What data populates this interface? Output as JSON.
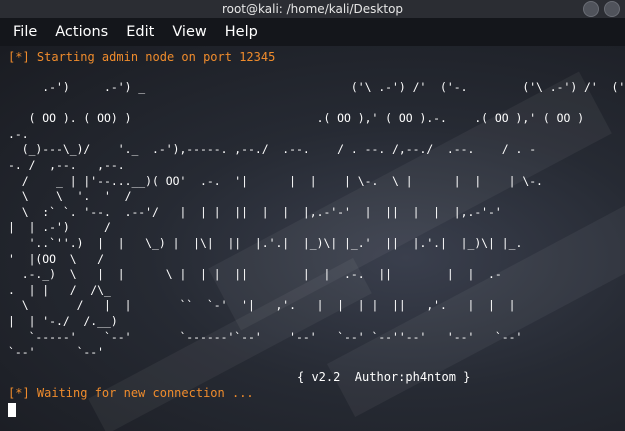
{
  "window": {
    "title": "root@kali: /home/kali/Desktop"
  },
  "menu": {
    "items": [
      "File",
      "Actions",
      "Edit",
      "View",
      "Help"
    ]
  },
  "terminal": {
    "status_start": "[*] Starting admin node on port 12345",
    "banner_art": "     .-')     .-') _                              ('\\ .-') /'  ('-.        ('\\ .-') /'  ('-.\n\n   ( OO ). ( OO) )                           .( OO ),' ( OO ).-.    .( OO ),' ( OO )\n.-.\n  (_)---\\_)/    '._  .-'),-----. ,--./  .--.    / . --. /,--./  .--.    / . -\n-. /  ,--.   ,--.\n  /    _ | |'--...__)( OO'  .-.  '|      |  |    | \\-.  \\ |      |  |    | \\-.\n  \\    \\  '.  '  /\n  \\  :` `. '--.  .--'/   |  | |  ||  |  |  |,.-'-'  |  ||  |  |  |,.-'-'\n|  | .-')     /\n   '..`''.)  |  |   \\_) |  |\\|  ||  |.'.|  |_)\\| |_.'  ||  |.'.|  |_)\\| |_.\n'  |(OO  \\   /\n  .-._)  \\   |  |      \\ |  | |  ||        |  |  .-.  ||        |  |  .-\n.  | |   /  /\\_\n  \\       /   |  |       ``  `-'  '|   ,'.   |  |  | |  ||   ,'.   |  |  |\n|  | '-./  /.__)\n   `-----'    `--'       `------'`--'    '--'   `--' `--''--'   '--'   `--'\n`--'      `--'",
    "version_line": "{ v2.2  Author:ph4ntom }",
    "status_wait": "[*] Waiting for new connection ..."
  },
  "colors": {
    "accent_orange": "#f08c2c",
    "text_white": "#ffffff",
    "menubar_bg": "#14161b",
    "titlebar_bg": "#2b2d33"
  }
}
